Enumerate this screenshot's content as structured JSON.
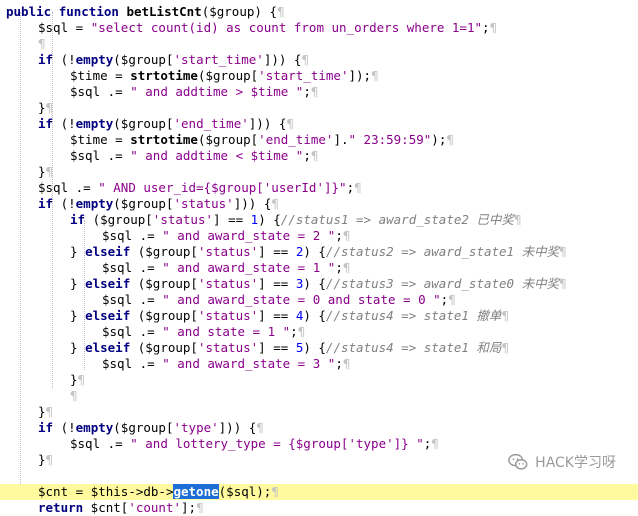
{
  "code": {
    "lines": [
      {
        "indent": 0,
        "tokens": [
          {
            "t": "public",
            "c": "kw"
          },
          {
            "t": " ",
            "c": "sp"
          },
          {
            "t": "function",
            "c": "kw"
          },
          {
            "t": " ",
            "c": "sp"
          },
          {
            "t": "betListCnt",
            "c": "fn"
          },
          {
            "t": "($group)",
            "c": "var"
          },
          {
            "t": " {",
            "c": "var"
          },
          {
            "t": "¶",
            "c": "pil"
          }
        ]
      },
      {
        "indent": 1,
        "tokens": [
          {
            "t": "$sql",
            "c": "var"
          },
          {
            "t": " = ",
            "c": "var"
          },
          {
            "t": "\"select count(id) as count from un_orders where 1=1\"",
            "c": "str"
          },
          {
            "t": ";",
            "c": "var"
          },
          {
            "t": "¶",
            "c": "pil"
          }
        ]
      },
      {
        "indent": 1,
        "tokens": [
          {
            "t": "¶",
            "c": "pil"
          }
        ]
      },
      {
        "indent": 1,
        "tokens": [
          {
            "t": "if",
            "c": "kw"
          },
          {
            "t": " (!",
            "c": "var"
          },
          {
            "t": "empty",
            "c": "kw"
          },
          {
            "t": "($group[",
            "c": "var"
          },
          {
            "t": "'start_time'",
            "c": "str"
          },
          {
            "t": "]))",
            "c": "var"
          },
          {
            "t": " {",
            "c": "var"
          },
          {
            "t": "¶",
            "c": "pil"
          }
        ]
      },
      {
        "indent": 2,
        "tokens": [
          {
            "t": "$time",
            "c": "var"
          },
          {
            "t": " = ",
            "c": "var"
          },
          {
            "t": "strtotime",
            "c": "fn"
          },
          {
            "t": "($group[",
            "c": "var"
          },
          {
            "t": "'start_time'",
            "c": "str"
          },
          {
            "t": "]);",
            "c": "var"
          },
          {
            "t": "¶",
            "c": "pil"
          }
        ]
      },
      {
        "indent": 2,
        "tokens": [
          {
            "t": "$sql",
            "c": "var"
          },
          {
            "t": " .= ",
            "c": "var"
          },
          {
            "t": "\" and addtime > $time \"",
            "c": "str"
          },
          {
            "t": ";",
            "c": "var"
          },
          {
            "t": "¶",
            "c": "pil"
          }
        ]
      },
      {
        "indent": 1,
        "tokens": [
          {
            "t": "}",
            "c": "var"
          },
          {
            "t": "¶",
            "c": "pil"
          }
        ]
      },
      {
        "indent": 1,
        "tokens": [
          {
            "t": "if",
            "c": "kw"
          },
          {
            "t": " (!",
            "c": "var"
          },
          {
            "t": "empty",
            "c": "kw"
          },
          {
            "t": "($group[",
            "c": "var"
          },
          {
            "t": "'end_time'",
            "c": "str"
          },
          {
            "t": "]))",
            "c": "var"
          },
          {
            "t": " {",
            "c": "var"
          },
          {
            "t": "¶",
            "c": "pil"
          }
        ]
      },
      {
        "indent": 2,
        "tokens": [
          {
            "t": "$time",
            "c": "var"
          },
          {
            "t": " = ",
            "c": "var"
          },
          {
            "t": "strtotime",
            "c": "fn"
          },
          {
            "t": "($group[",
            "c": "var"
          },
          {
            "t": "'end_time'",
            "c": "str"
          },
          {
            "t": "].",
            "c": "var"
          },
          {
            "t": "\" 23:59:59\"",
            "c": "str"
          },
          {
            "t": ");",
            "c": "var"
          },
          {
            "t": "¶",
            "c": "pil"
          }
        ]
      },
      {
        "indent": 2,
        "tokens": [
          {
            "t": "$sql",
            "c": "var"
          },
          {
            "t": " .= ",
            "c": "var"
          },
          {
            "t": "\" and addtime < $time \"",
            "c": "str"
          },
          {
            "t": ";",
            "c": "var"
          },
          {
            "t": "¶",
            "c": "pil"
          }
        ]
      },
      {
        "indent": 1,
        "tokens": [
          {
            "t": "}",
            "c": "var"
          },
          {
            "t": "¶",
            "c": "pil"
          }
        ]
      },
      {
        "indent": 1,
        "tokens": [
          {
            "t": "$sql",
            "c": "var"
          },
          {
            "t": " .= ",
            "c": "var"
          },
          {
            "t": "\" AND user_id={$group['userId']}\"",
            "c": "str"
          },
          {
            "t": ";",
            "c": "var"
          },
          {
            "t": "¶",
            "c": "pil"
          }
        ]
      },
      {
        "indent": 1,
        "tokens": [
          {
            "t": "if",
            "c": "kw"
          },
          {
            "t": " (!",
            "c": "var"
          },
          {
            "t": "empty",
            "c": "kw"
          },
          {
            "t": "($group[",
            "c": "var"
          },
          {
            "t": "'status'",
            "c": "str"
          },
          {
            "t": "]))",
            "c": "var"
          },
          {
            "t": " {",
            "c": "var"
          },
          {
            "t": "¶",
            "c": "pil"
          }
        ]
      },
      {
        "indent": 2,
        "tokens": [
          {
            "t": "if",
            "c": "kw"
          },
          {
            "t": " ($group[",
            "c": "var"
          },
          {
            "t": "'status'",
            "c": "str"
          },
          {
            "t": "] == ",
            "c": "var"
          },
          {
            "t": "1",
            "c": "num"
          },
          {
            "t": ") {",
            "c": "var"
          },
          {
            "t": "//status1 => award_state2 已中奖",
            "c": "cm"
          },
          {
            "t": "¶",
            "c": "pil"
          }
        ]
      },
      {
        "indent": 3,
        "tokens": [
          {
            "t": "$sql",
            "c": "var"
          },
          {
            "t": " .= ",
            "c": "var"
          },
          {
            "t": "\" and award_state = 2 \"",
            "c": "str"
          },
          {
            "t": ";",
            "c": "var"
          },
          {
            "t": "¶",
            "c": "pil"
          }
        ]
      },
      {
        "indent": 2,
        "tokens": [
          {
            "t": "} ",
            "c": "var"
          },
          {
            "t": "elseif",
            "c": "kw"
          },
          {
            "t": " ($group[",
            "c": "var"
          },
          {
            "t": "'status'",
            "c": "str"
          },
          {
            "t": "] == ",
            "c": "var"
          },
          {
            "t": "2",
            "c": "num"
          },
          {
            "t": ") {",
            "c": "var"
          },
          {
            "t": "//status2 => award_state1 未中奖",
            "c": "cm"
          },
          {
            "t": "¶",
            "c": "pil"
          }
        ]
      },
      {
        "indent": 3,
        "tokens": [
          {
            "t": "$sql",
            "c": "var"
          },
          {
            "t": " .= ",
            "c": "var"
          },
          {
            "t": "\" and award_state = 1 \"",
            "c": "str"
          },
          {
            "t": ";",
            "c": "var"
          },
          {
            "t": "¶",
            "c": "pil"
          }
        ]
      },
      {
        "indent": 2,
        "tokens": [
          {
            "t": "} ",
            "c": "var"
          },
          {
            "t": "elseif",
            "c": "kw"
          },
          {
            "t": " ($group[",
            "c": "var"
          },
          {
            "t": "'status'",
            "c": "str"
          },
          {
            "t": "] == ",
            "c": "var"
          },
          {
            "t": "3",
            "c": "num"
          },
          {
            "t": ") {",
            "c": "var"
          },
          {
            "t": "//status3 => award_state0 未中奖",
            "c": "cm"
          },
          {
            "t": "¶",
            "c": "pil"
          }
        ]
      },
      {
        "indent": 3,
        "tokens": [
          {
            "t": "$sql",
            "c": "var"
          },
          {
            "t": " .= ",
            "c": "var"
          },
          {
            "t": "\" and award_state = 0 and state = 0 \"",
            "c": "str"
          },
          {
            "t": ";",
            "c": "var"
          },
          {
            "t": "¶",
            "c": "pil"
          }
        ]
      },
      {
        "indent": 2,
        "tokens": [
          {
            "t": "} ",
            "c": "var"
          },
          {
            "t": "elseif",
            "c": "kw"
          },
          {
            "t": " ($group[",
            "c": "var"
          },
          {
            "t": "'status'",
            "c": "str"
          },
          {
            "t": "] == ",
            "c": "var"
          },
          {
            "t": "4",
            "c": "num"
          },
          {
            "t": ") {",
            "c": "var"
          },
          {
            "t": "//status4 => state1 撤单",
            "c": "cm"
          },
          {
            "t": "¶",
            "c": "pil"
          }
        ]
      },
      {
        "indent": 3,
        "tokens": [
          {
            "t": "$sql",
            "c": "var"
          },
          {
            "t": " .= ",
            "c": "var"
          },
          {
            "t": "\" and state = 1 \"",
            "c": "str"
          },
          {
            "t": ";",
            "c": "var"
          },
          {
            "t": "¶",
            "c": "pil"
          }
        ]
      },
      {
        "indent": 2,
        "tokens": [
          {
            "t": "} ",
            "c": "var"
          },
          {
            "t": "elseif",
            "c": "kw"
          },
          {
            "t": " ($group[",
            "c": "var"
          },
          {
            "t": "'status'",
            "c": "str"
          },
          {
            "t": "] == ",
            "c": "var"
          },
          {
            "t": "5",
            "c": "num"
          },
          {
            "t": ") {",
            "c": "var"
          },
          {
            "t": "//status4 => state1 和局",
            "c": "cm"
          },
          {
            "t": "¶",
            "c": "pil"
          }
        ]
      },
      {
        "indent": 3,
        "tokens": [
          {
            "t": "$sql",
            "c": "var"
          },
          {
            "t": " .= ",
            "c": "var"
          },
          {
            "t": "\" and award_state = 3 \"",
            "c": "str"
          },
          {
            "t": ";",
            "c": "var"
          },
          {
            "t": "¶",
            "c": "pil"
          }
        ]
      },
      {
        "indent": 2,
        "tokens": [
          {
            "t": "}",
            "c": "var"
          },
          {
            "t": "¶",
            "c": "pil"
          }
        ]
      },
      {
        "indent": 2,
        "tokens": [
          {
            "t": "¶",
            "c": "pil"
          }
        ]
      },
      {
        "indent": 1,
        "tokens": [
          {
            "t": "}",
            "c": "var"
          },
          {
            "t": "¶",
            "c": "pil"
          }
        ]
      },
      {
        "indent": 1,
        "tokens": [
          {
            "t": "if",
            "c": "kw"
          },
          {
            "t": " (!",
            "c": "var"
          },
          {
            "t": "empty",
            "c": "kw"
          },
          {
            "t": "($group[",
            "c": "var"
          },
          {
            "t": "'type'",
            "c": "str"
          },
          {
            "t": "]))",
            "c": "var"
          },
          {
            "t": " {",
            "c": "var"
          },
          {
            "t": "¶",
            "c": "pil"
          }
        ]
      },
      {
        "indent": 2,
        "tokens": [
          {
            "t": "$sql",
            "c": "var"
          },
          {
            "t": " .= ",
            "c": "var"
          },
          {
            "t": "\" and lottery_type = {$group['type']} \"",
            "c": "str"
          },
          {
            "t": ";",
            "c": "var"
          },
          {
            "t": "¶",
            "c": "pil"
          }
        ]
      },
      {
        "indent": 1,
        "tokens": [
          {
            "t": "}",
            "c": "var"
          },
          {
            "t": "¶",
            "c": "pil"
          }
        ]
      },
      {
        "indent": 1,
        "tokens": [
          {
            "t": "",
            "c": "sp"
          }
        ]
      },
      {
        "indent": 1,
        "highlight": true,
        "tokens": [
          {
            "t": "$cnt",
            "c": "var"
          },
          {
            "t": " = ",
            "c": "var"
          },
          {
            "t": "$this",
            "c": "var"
          },
          {
            "t": "->db->",
            "c": "var"
          },
          {
            "t": "getone",
            "c": "sel"
          },
          {
            "t": "($sql);",
            "c": "var"
          },
          {
            "t": "¶",
            "c": "pil"
          }
        ]
      },
      {
        "indent": 1,
        "tokens": [
          {
            "t": "return",
            "c": "kw"
          },
          {
            "t": " $cnt[",
            "c": "var"
          },
          {
            "t": "'count'",
            "c": "str"
          },
          {
            "t": "];",
            "c": "var"
          },
          {
            "t": "¶",
            "c": "pil"
          }
        ]
      }
    ]
  },
  "watermark": {
    "text": "HACK学习呀",
    "icon": "wechat-icon"
  }
}
